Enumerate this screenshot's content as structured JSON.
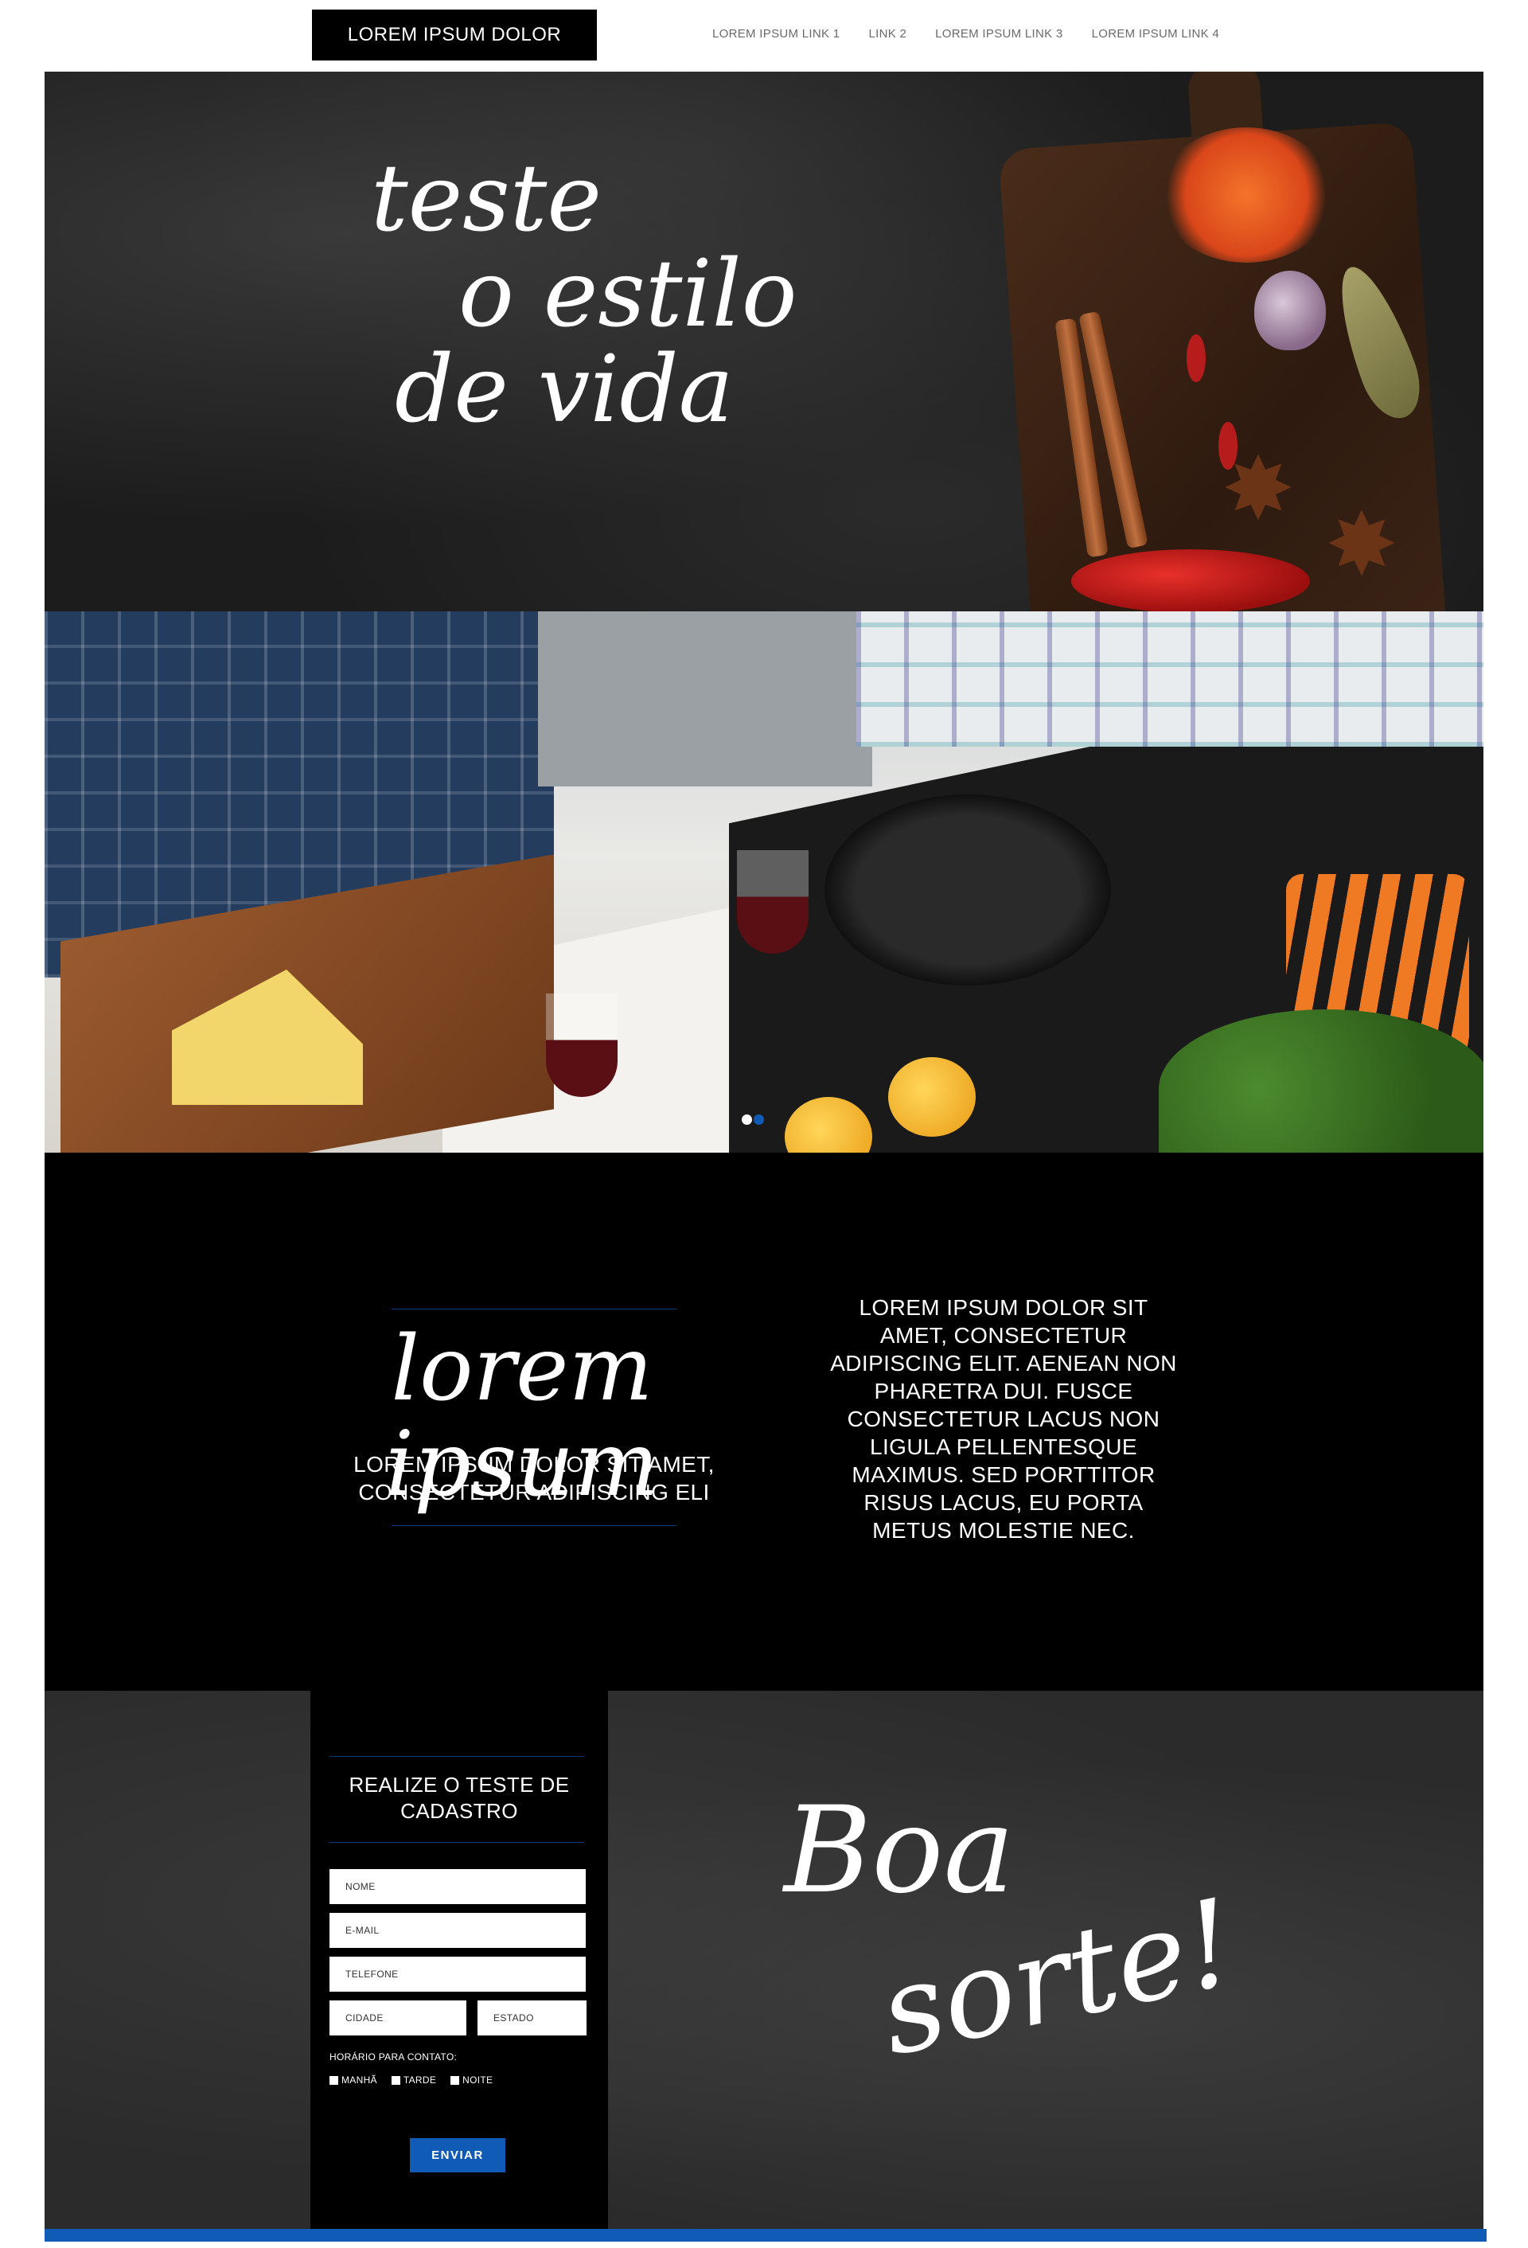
{
  "header": {
    "logo": "LOREM IPSUM DOLOR",
    "nav": [
      "LOREM IPSUM LINK 1",
      "LINK 2",
      "LOREM IPSUM LINK 3",
      "LOREM IPSUM LINK 4"
    ]
  },
  "hero1": {
    "script_lines": [
      "teste",
      "o estilo",
      "de vida"
    ]
  },
  "hero2": {
    "slider": {
      "dots": 2,
      "active_index": 0,
      "active_color": "#ffffff",
      "inactive_color": "#0f5bb5"
    }
  },
  "intro": {
    "script_title": "lorem ipsum",
    "subtitle": "LOREM IPSUM DOLOR SIT AMET, CONSECTETUR ADIPISCING ELI",
    "paragraph": "LOREM IPSUM DOLOR SIT AMET, CONSECTETUR ADIPISCING ELIT. AENEAN NON PHARETRA DUI. FUSCE CONSECTETUR LACUS NON LIGULA PELLENTESQUE MAXIMUS. SED PORTTITOR RISUS LACUS, EU PORTA METUS MOLESTIE NEC."
  },
  "form": {
    "title": "REALIZE O TESTE DE CADASTRO",
    "fields": {
      "name": "NOME",
      "email": "E-MAIL",
      "phone": "TELEFONE",
      "city": "CIDADE",
      "state": "ESTADO"
    },
    "contact_label": "HORÁRIO PARA CONTATO:",
    "options": [
      "MANHÃ",
      "TARDE",
      "NOITE"
    ],
    "submit": "ENVIAR"
  },
  "closing": {
    "script_lines": [
      "Boa",
      "sorte!"
    ]
  },
  "colors": {
    "accent_blue": "#0f5bb5",
    "rule_blue": "#0b3d80",
    "dark": "#000000"
  }
}
